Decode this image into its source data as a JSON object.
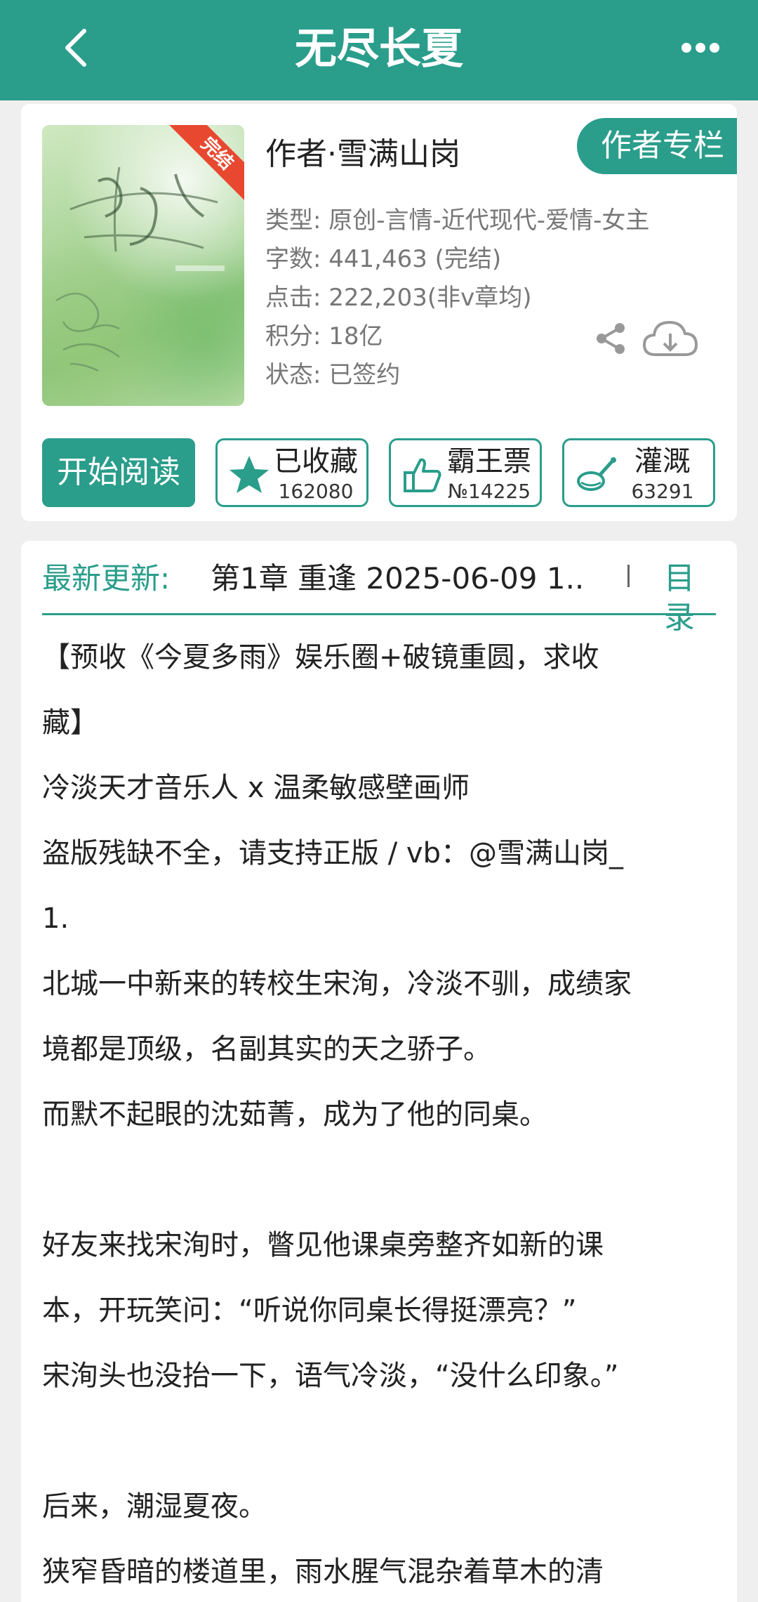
{
  "header": {
    "title": "无尽长夏",
    "back_icon": "back-chevron-icon",
    "more_icon": "more-dots-icon"
  },
  "book": {
    "cover_badge": "完结",
    "author": "作者·雪满山岗",
    "author_column_label": "作者专栏",
    "meta": {
      "type": "类型: 原创-言情-近代现代-爱情-女主",
      "words": "字数: 441,463 (完结)",
      "clicks": "点击: 222,203(非v章均)",
      "score": "积分: 18亿",
      "status": "状态: 已签约"
    },
    "actions": {
      "read": "开始阅读",
      "favorite": {
        "label": "已收藏",
        "count": "162080"
      },
      "vote": {
        "label": "霸王票",
        "count": "№14225"
      },
      "nourish": {
        "label": "灌溉",
        "count": "63291"
      }
    }
  },
  "latest": {
    "label": "最新更新:",
    "chapter": "第1章  重逢  2025-06-09 1..",
    "toc": "目录"
  },
  "intro": [
    "【预收《今夏多雨》娱乐圈+破镜重圆，求收",
    "藏】",
    "冷淡天才音乐人 x 温柔敏感壁画师",
    "盗版残缺不全，请支持正版 / vb：@雪满山岗_",
    "1.",
    "北城一中新来的转校生宋洵，冷淡不驯，成绩家",
    "境都是顶级，名副其实的天之骄子。",
    "而默不起眼的沈茹菁，成为了他的同桌。",
    "",
    "好友来找宋洵时，瞥见他课桌旁整齐如新的课",
    "本，开玩笑问：“听说你同桌长得挺漂亮？”",
    "宋洵头也没抬一下，语气冷淡，“没什么印象。”",
    "",
    "后来，潮湿夏夜。",
    "狭窄昏暗的楼道里，雨水腥气混杂着草木的清"
  ],
  "colors": {
    "accent": "#2a9d8b",
    "badge": "#e8482f",
    "meta_text": "#777777"
  }
}
